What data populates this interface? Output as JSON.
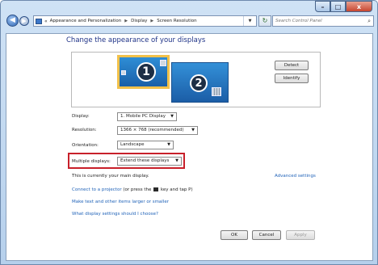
{
  "window": {
    "caption": {
      "minimize": "–",
      "maximize": "□",
      "close": "x"
    }
  },
  "nav": {
    "back": "◀",
    "forward": "▶",
    "overflow": "«",
    "breadcrumbs": [
      "Appearance and Personalization",
      "Display",
      "Screen Resolution"
    ],
    "separator": "▶",
    "dropdown": "▼",
    "refresh": "↻",
    "search_placeholder": "Search Control Panel",
    "search_icon": "magnifier-icon"
  },
  "page": {
    "title": "Change the appearance of your displays",
    "monitor_1_number": "1",
    "monitor_2_number": "2",
    "detect_label": "Detect",
    "identify_label": "Identify"
  },
  "settings": {
    "display_label": "Display:",
    "display_value": "1. Mobile PC Display",
    "resolution_label": "Resolution:",
    "resolution_value": "1366 × 768 (recommended)",
    "orientation_label": "Orientation:",
    "orientation_value": "Landscape",
    "multiple_label": "Multiple displays:",
    "multiple_value": "Extend these displays",
    "dropdown_arrow": "▼",
    "highlight_color": "#c8202a"
  },
  "info": {
    "main_display_note": "This is currently your main display.",
    "advanced_link": "Advanced settings",
    "projector_link": "Connect to a projector",
    "projector_note_pre": "(or press the",
    "projector_note_post": "key and tap P)",
    "larger_link": "Make text and other items larger or smaller",
    "what_link": "What display settings should I choose?"
  },
  "footer": {
    "ok_label": "OK",
    "cancel_label": "Cancel",
    "apply_label": "Apply"
  }
}
